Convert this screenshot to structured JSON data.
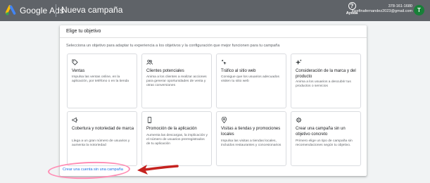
{
  "topbar": {
    "brand": "Google Ads",
    "page_title": "Nueva campaña",
    "help_label": "Ayuda",
    "account_id": "378-161-1680",
    "account_email": "josefinafernandez2023@gmail.com",
    "avatar_letter": "T"
  },
  "panel": {
    "title": "Elige tu objetivo",
    "subtitle": "Selecciona un objetivo para adaptar tu experiencia a los objetivos y la configuración que mejor funcionen para tu campaña",
    "cards": [
      {
        "title": "Ventas",
        "desc": "Impulsa las ventas online, en la aplicación, por teléfono o en la tienda",
        "icon": "tag-icon"
      },
      {
        "title": "Clientes potenciales",
        "desc": "Anima a los clientes a realizar acciones para generar oportunidades de venta y otras conversiones",
        "icon": "people-icon"
      },
      {
        "title": "Tráfico al sitio web",
        "desc": "Consigue que los usuarios adecuados visiten tu sitio web",
        "icon": "cursor-click-icon"
      },
      {
        "title": "Consideración de la marca y del producto",
        "desc": "Anima a los usuarios a descubrir tus productos o servicios",
        "icon": "sparkle-icon"
      },
      {
        "title": "Cobertura y notoriedad de marca",
        "desc": "Llega a un gran número de usuarios y aumenta la notoriedad",
        "icon": "megaphone-icon"
      },
      {
        "title": "Promoción de la aplicación",
        "desc": "Aumenta las descargas, la implicación y el número de usuarios prerregistrados de tu aplicación",
        "icon": "phone-icon"
      },
      {
        "title": "Visitas a tiendas y promociones locales",
        "desc": "Impulsa las visitas a tiendas locales, incluidos restaurantes y concesionarios",
        "icon": "location-pin-icon"
      },
      {
        "title": "Crear una campaña sin un objetivo concreto",
        "desc": "Primero elige un tipo de campaña sin recomendaciones según tu objetivo.",
        "icon": "gear-icon"
      }
    ]
  },
  "create_link": "Crear una cuenta sin una campaña",
  "colors": {
    "topbar": "#5f6368",
    "link": "#1a73e8",
    "highlight": "#ff8db4",
    "arrow": "#c5221f",
    "avatar": "#188038"
  }
}
